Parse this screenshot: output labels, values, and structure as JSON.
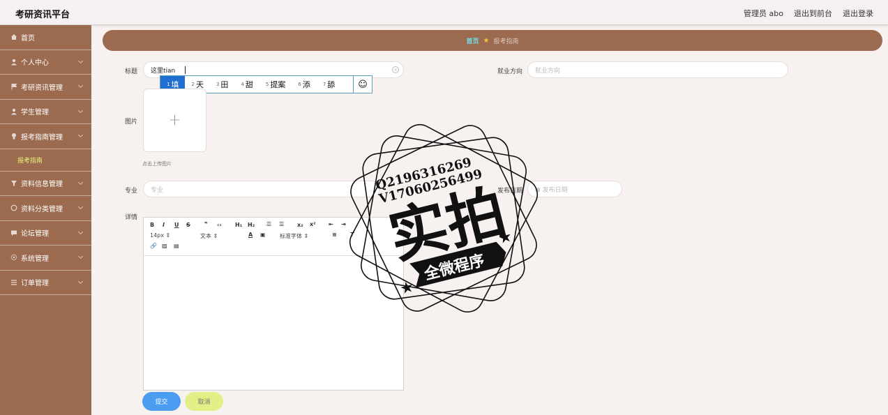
{
  "header": {
    "title": "考研资讯平台",
    "admin": "管理员 abo",
    "exit_front": "退出到前台",
    "logout": "退出登录"
  },
  "sidebar": {
    "items": [
      {
        "label": "首页",
        "icon": "home-icon"
      },
      {
        "label": "个人中心",
        "icon": "user-icon"
      },
      {
        "label": "考研资讯管理",
        "icon": "flag-icon"
      },
      {
        "label": "学生管理",
        "icon": "user-icon"
      },
      {
        "label": "报考指南管理",
        "icon": "bulb-icon"
      }
    ],
    "sub_item": "报考指南",
    "items2": [
      {
        "label": "资料信息管理",
        "icon": "funnel-icon"
      },
      {
        "label": "资料分类管理",
        "icon": "circle-icon"
      },
      {
        "label": "论坛管理",
        "icon": "comment-icon"
      },
      {
        "label": "系统管理",
        "icon": "gear-icon"
      },
      {
        "label": "订单管理",
        "icon": "list-icon"
      }
    ]
  },
  "breadcrumb": {
    "home": "首页",
    "current": "报考指南"
  },
  "form": {
    "title_label": "标题",
    "title_value": "这里tian",
    "direction_label": "就业方向",
    "direction_placeholder": "就业方向",
    "image_label": "图片",
    "upload_hint": "点击上传图片",
    "major_label": "专业",
    "major_placeholder": "专业",
    "date_label": "发布日期",
    "date_placeholder": "发布日期",
    "detail_label": "详情"
  },
  "ime": {
    "candidates": [
      {
        "n": "1",
        "text": "填"
      },
      {
        "n": "2",
        "text": "天"
      },
      {
        "n": "3",
        "text": "田"
      },
      {
        "n": "4",
        "text": "甜"
      },
      {
        "n": "5",
        "text": "提案"
      },
      {
        "n": "6",
        "text": "添"
      },
      {
        "n": "7",
        "text": "舔"
      }
    ],
    "emoji": "☺"
  },
  "editor": {
    "size": "14px",
    "format": "文本",
    "font": "标准字体"
  },
  "buttons": {
    "submit": "提交",
    "cancel": "取消"
  },
  "watermark": {
    "line1": "Q2196316269",
    "line2": "V17060256499",
    "big": "实拍",
    "ribbon": "全微程序"
  }
}
